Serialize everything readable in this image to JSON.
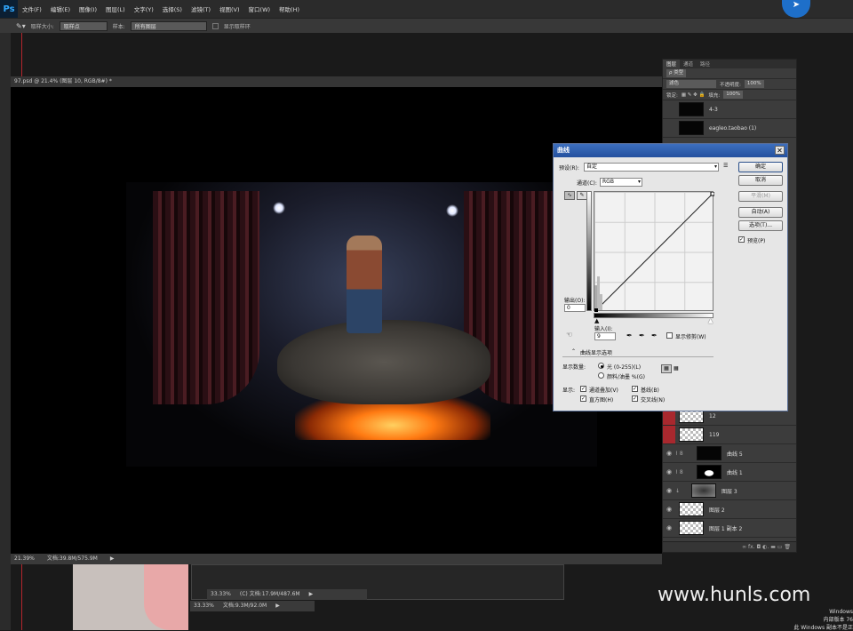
{
  "menubar": {
    "logo": "Ps",
    "items": [
      "文件(F)",
      "编辑(E)",
      "图像(I)",
      "图层(L)",
      "文字(Y)",
      "选择(S)",
      "滤镜(T)",
      "视图(V)",
      "窗口(W)",
      "帮助(H)"
    ]
  },
  "options": {
    "sample_size_label": "取样大小:",
    "sample_size_value": "取样点",
    "sample_label": "样本:",
    "sample_value": "所有图层",
    "show_ring_label": "显示取样环"
  },
  "document": {
    "tab_title": "97.psd @ 21.4% (图层 10, RGB/8#) *",
    "zoom": "21.39%",
    "doc_size": "文档:39.8M/575.9M"
  },
  "lower_docs": [
    {
      "zoom": "33.33%",
      "doc_size": "(C) 文档:17.9M/487.6M"
    },
    {
      "zoom": "33.33%",
      "doc_size": "文档:9.3M/92.0M"
    }
  ],
  "watermark": "www.hunls.com",
  "windows_mark": {
    "line1": "Windows",
    "line2": "内部版本 76",
    "line3": "此 Windows 副本不是正"
  },
  "layers_panel": {
    "tabs": [
      "图层",
      "通道",
      "路径"
    ],
    "kind_label": "ρ 类型",
    "blend_mode": "滤色",
    "opacity_label": "不透明度:",
    "opacity_value": "100%",
    "lock_label": "锁定:",
    "fill_label": "填充:",
    "fill_value": "100%",
    "layers": [
      {
        "name": "4-3"
      },
      {
        "name": "eagleo.taobao (1)"
      },
      {
        "name": "12"
      },
      {
        "name": "119"
      },
      {
        "name": "曲线 5"
      },
      {
        "name": "曲线 1"
      },
      {
        "name": "图层 3"
      },
      {
        "name": "图层 2"
      },
      {
        "name": "图层 1 副本 2"
      }
    ],
    "bottom_icons": "∞ fx. ◘ ◐. ▬ ▭ 🗑"
  },
  "curves": {
    "title": "曲线",
    "preset_label": "预设(R):",
    "preset_value": "自定",
    "channel_label": "通道(C):",
    "channel_value": "RGB",
    "output_label": "输出(O):",
    "output_value": "0",
    "input_label": "输入(I):",
    "input_value": "9",
    "show_clipping": "显示修剪(W)",
    "display_options": "曲线显示选项",
    "show_amount_label": "显示数量:",
    "light_option": "光 (0-255)(L)",
    "pigment_option": "颜料/油墨 %(G)",
    "show_label": "显示:",
    "channel_overlays": "通道叠加(V)",
    "baseline": "基线(B)",
    "histogram": "直方图(H)",
    "intersection": "交叉线(N)",
    "btn_ok": "确定",
    "btn_cancel": "取消",
    "btn_smooth": "平滑(M)",
    "btn_auto": "自动(A)",
    "btn_options": "选项(T)...",
    "preview_label": "预览(P)"
  }
}
